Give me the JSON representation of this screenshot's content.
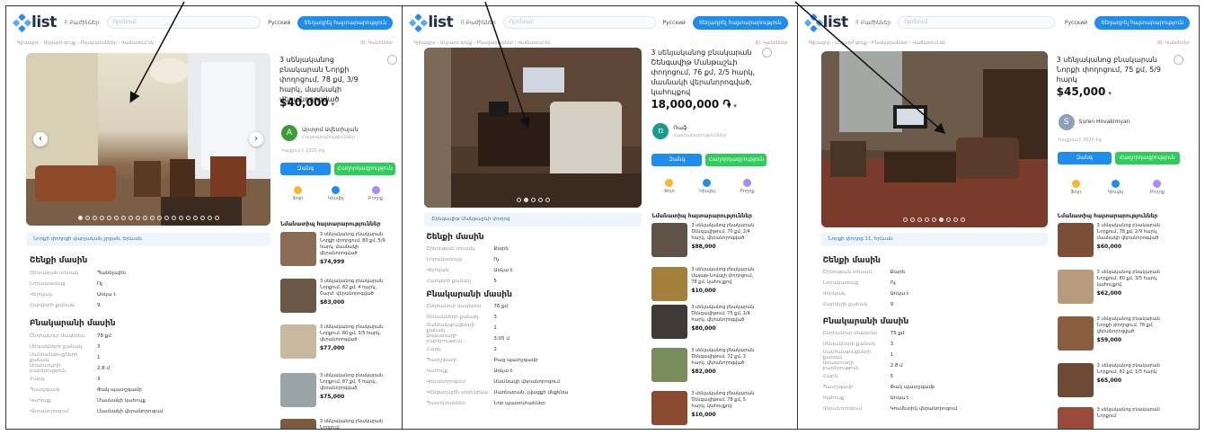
{
  "header": {
    "logo": "list",
    "categories_label": "Բաժիններ",
    "search_placeholder": "Որոնում",
    "language": "Русский",
    "post_button": "Տեղադրել հայտարարություն"
  },
  "breadcrumbs": "Գլխավոր › Անշարժ գույք › Բնակարաններ › Վաճառում են",
  "breadcrumb_right": "ID: Կանոններ",
  "panels": [
    {
      "title": "3 սենյականոց բնակարան Նորքի փողոցում, 78 քմ, 3/9 հարկ, մասնակի վերանորոգված",
      "price": "$40,000",
      "price_suffix": "▾",
      "seller_initial": "A",
      "seller_name": "Արտյոմ Ավետիսյան",
      "seller_sub": "Հայտարարություններ",
      "note": "Կայքում է 2021-ից",
      "call": "Զանգ",
      "message": "Հաղորդագրություն",
      "act1": "Ֆոլո",
      "act2": "Կիսվել",
      "act3": "Բողոք",
      "similar_heading": "Նմանատիպ հայտարարություններ",
      "similar": [
        {
          "text": "3 սենյականոց բնակարան Նորքի փողոցում, 80 քմ, 5/9 հարկ, մասնակի վերանորոգված",
          "price": "$74,999"
        },
        {
          "text": "3 սենյականոց բնակարան Նորքում, 82 քմ, 4 հարկ, Շարժ. վերանորոգված",
          "price": "$83,000"
        },
        {
          "text": "3 սենյականոց բնակարան Նորքում, 80 քմ, 3/5 հարկ, վերանորոգված",
          "price": "$77,000"
        },
        {
          "text": "3 սենյականոց բնակարան Նորքում, 87 քմ, 5 հարկ, վերանորոգված",
          "price": "$75,000"
        },
        {
          "text": "3 սենյականոց բնակարան Նորքում",
          "price": ""
        }
      ],
      "location": "Նորքի փողոցի վարչական շրջան, Երևան",
      "building_heading": "Շենքի մասին",
      "building_rows": [
        [
          "Շինության տեսակ",
          "Պանելային"
        ],
        [
          "Նորակառույց",
          "Ոչ"
        ],
        [
          "Վերելակ",
          "Առկա է"
        ],
        [
          "Հարկերի քանակ",
          "9"
        ]
      ],
      "apartment_heading": "Բնակարանի մասին",
      "apartment_rows": [
        [
          "Ընդհանուր մակերես",
          "78 քմ"
        ],
        [
          "Սենյակների քանակ",
          "3"
        ],
        [
          "Սանհանգույցների քանակ",
          "1"
        ],
        [
          "Առաստաղի բարձրություն",
          "2.8 մ"
        ],
        [
          "Հարկ",
          "3"
        ],
        [
          "Պատշգամբ",
          "Փակ պատշգամբ"
        ],
        [
          "Կահույք",
          "Մասնակի կահույք"
        ],
        [
          "Վերանորոգում",
          "Մասնակի վերանորոգում"
        ]
      ]
    },
    {
      "title": "3 սենյականոց բնակարան Շենգավիթ Մանթաշևի փողոցում, 76 քմ, 2/5 հարկ, մասնակի վերանորոգված, կահույքով",
      "price": "18,000,000 ֏",
      "price_suffix": "▾",
      "seller_initial": "ռ",
      "seller_name": "Ռաֆ",
      "seller_sub": "Հայտարարություններ",
      "note": "",
      "call": "Զանգ",
      "message": "Հաղորդագրություն",
      "act1": "Ֆոլո",
      "act2": "Կիսվել",
      "act3": "Բողոք",
      "similar_heading": "Նմանատիպ հայտարարություններ",
      "similar": [
        {
          "text": "3 սենյականոց բնակարան Շենգավիթում, 70 քմ, 2/4 հարկ, վերանորոգված",
          "price": "$88,000"
        },
        {
          "text": "3 սենյականոց բնակարան Սայաթ-Նովայի փողոցում, 78 քմ, կահույքով",
          "price": "$10,000"
        },
        {
          "text": "3 սենյականոց բնակարան Շենգավիթում, 75 քմ, 1/4 հարկ, վերանորոգված",
          "price": "$80,000"
        },
        {
          "text": "3 սենյականոց բնակարան Շենգավիթում, 72 քմ, 3 հարկ, վերանորոգված",
          "price": "$82,000"
        },
        {
          "text": "3 սենյականոց բնակարան Շենգավիթում, 78 քմ, 5 հարկ, կահույքով",
          "price": "$10,000"
        }
      ],
      "location": "Շենգավիթ Մանթաշևի փողոց",
      "building_heading": "Շենքի մասին",
      "building_rows": [
        [
          "Շինության տեսակ",
          "Քարե"
        ],
        [
          "Նորակառույց",
          "Ոչ"
        ],
        [
          "Վերելակ",
          "Առկա է"
        ],
        [
          "Հարկերի քանակ",
          "5"
        ]
      ],
      "apartment_heading": "Բնակարանի մասին",
      "apartment_rows": [
        [
          "Ընդհանուր մակերես",
          "76 քմ"
        ],
        [
          "Սենյակների քանակ",
          "3"
        ],
        [
          "Սանհանգույցների քանակ",
          "1"
        ],
        [
          "Առաստաղի բարձրություն",
          "3.05 մ"
        ],
        [
          "Հարկ",
          "2"
        ],
        [
          "Պատշգամբ",
          "Բաց պատշգամբ"
        ],
        [
          "Կահույք",
          "Առկա է"
        ],
        [
          "Վերանորոգում",
          "Մասնակի վերանորոգում"
        ],
        [
          "Կենցաղային տեխնիկա",
          "Սառնարան, լվացքի մեքենա"
        ],
        [
          "Պատուհաններ",
          "Նոր պատուհաններ"
        ]
      ]
    },
    {
      "title": "3 սենյականոց բնակարան Նորքի փողոցում, 75 քմ, 5/9 հարկ",
      "price": "$45,000",
      "price_suffix": "▾",
      "seller_initial": "S",
      "seller_name": "Suren Hovakimyan",
      "seller_sub": "",
      "note": "Կայքում է 2022-ից",
      "call": "Զանգ",
      "message": "Հաղորդագրություն",
      "act1": "Ֆոլո",
      "act2": "Կիսվել",
      "act3": "Բողոք",
      "similar_heading": "Նմանատիպ հայտարարություններ",
      "similar": [
        {
          "text": "3 սենյականոց բնակարան Նորքում, 78 քմ, 2/9 հարկ, մասնակի վերանորոգված",
          "price": "$60,000"
        },
        {
          "text": "3 սենյականոց բնակարան Նորքում, 80 քմ, 3/5 հարկ, կահույքով",
          "price": "$62,000"
        },
        {
          "text": "3 սենյականոց բնակարան Նորքի փողոցում, 76 քմ, վերանորոգված",
          "price": "$59,000"
        },
        {
          "text": "3 սենյականոց բնակարան Նորքում, 82 քմ, 1/5 հարկ",
          "price": "$65,000"
        },
        {
          "text": "3 սենյականոց բնակարան Նորքում",
          "price": ""
        }
      ],
      "location": "Նորքի փողոց 11, Երևան",
      "building_heading": "Շենքի մասին",
      "building_rows": [
        [
          "Շինության տեսակ",
          "Քարե"
        ],
        [
          "Նորակառույց",
          "Ոչ"
        ],
        [
          "Վերելակ",
          "Առկա է"
        ],
        [
          "Հարկերի քանակ",
          "9"
        ]
      ],
      "apartment_heading": "Բնակարանի մասին",
      "apartment_rows": [
        [
          "Ընդհանուր մակերես",
          "75 քմ"
        ],
        [
          "Սենյակների քանակ",
          "3"
        ],
        [
          "Սանհանգույցների քանակ",
          "1"
        ],
        [
          "Առաստաղի բարձրություն",
          "2.8 մ"
        ],
        [
          "Հարկ",
          "5"
        ],
        [
          "Պատշգամբ",
          "Փակ պատշգամբ"
        ],
        [
          "Կահույք",
          "Առկա է"
        ],
        [
          "Վերանորոգում",
          "Կոսմետիկ վերանորոգում"
        ]
      ]
    }
  ],
  "colors": {
    "accent": "#1f8cf0",
    "call": "#1f8cf0",
    "message": "#2ecc5a",
    "avatar1": "#3a9d3a",
    "avatar2": "#1a9c8c",
    "avatar3": "#8da0b8"
  }
}
